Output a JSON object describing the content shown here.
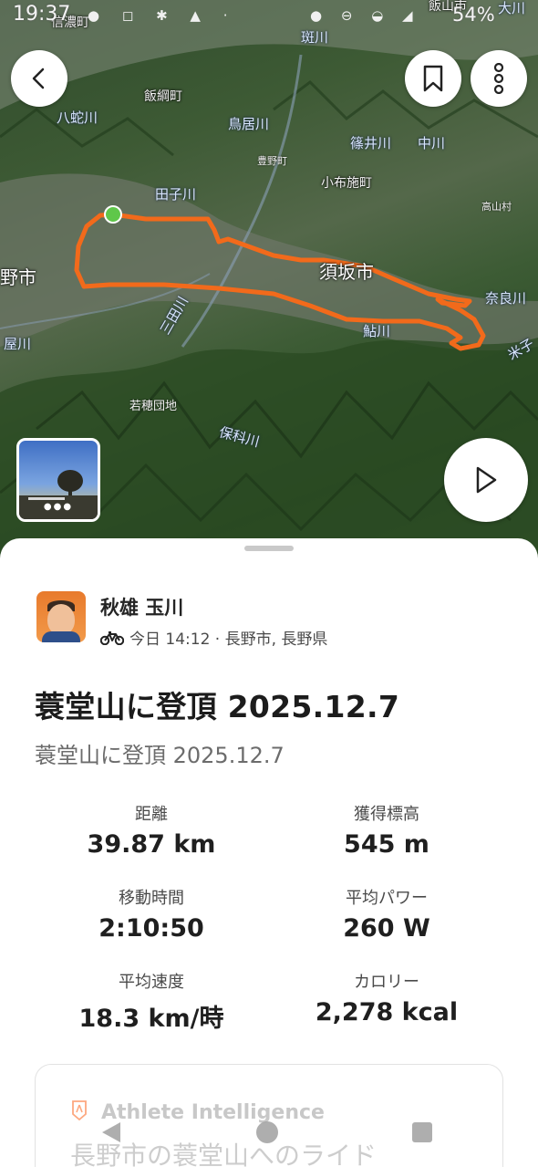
{
  "status_bar": {
    "time": "19:37",
    "battery": "54%"
  },
  "map": {
    "labels": {
      "l1": "信濃町",
      "l2": "飯山市",
      "l3": "大川",
      "l4": "斑川",
      "l5": "飯綱町",
      "l6": "八蛇川",
      "l7": "鳥居川",
      "l8": "篠井川",
      "l9": "中川",
      "l10": "豊野町",
      "l11": "小布施町",
      "l12": "田子川",
      "l13": "高山村",
      "l14": "野市",
      "l15": "須坂市",
      "l16": "奈良川",
      "l17": "三田川",
      "l18": "鮎川",
      "l19": "米子",
      "l20": "屋川",
      "l21": "若穂団地",
      "l22": "保科川"
    },
    "route_color": "#f26a1b",
    "start_marker_color": "#5fc74a"
  },
  "buttons": {
    "back": "back",
    "bookmark": "bookmark",
    "more": "more",
    "play": "play"
  },
  "activity": {
    "athlete_name": "秋雄 玉川",
    "meta": "今日 14:12 · 長野市, 長野県",
    "title": "蓑堂山に登頂 2025.12.7",
    "description": "蓑堂山に登頂 2025.12.7",
    "stats": {
      "distance": {
        "label": "距離",
        "value": "39.87 km"
      },
      "elevation": {
        "label": "獲得標高",
        "value": "545 m"
      },
      "moving_time": {
        "label": "移動時間",
        "value": "2:10:50"
      },
      "avg_power": {
        "label": "平均パワー",
        "value": "260 W"
      },
      "avg_speed": {
        "label": "平均速度",
        "value": "18.3 km/時"
      },
      "calories": {
        "label": "カロリー",
        "value": "2,278 kcal"
      }
    },
    "ai_card": {
      "title": "Athlete Intelligence",
      "text": "長野市の蓑堂山へのライド"
    }
  },
  "colors": {
    "accent": "#fc5200"
  }
}
